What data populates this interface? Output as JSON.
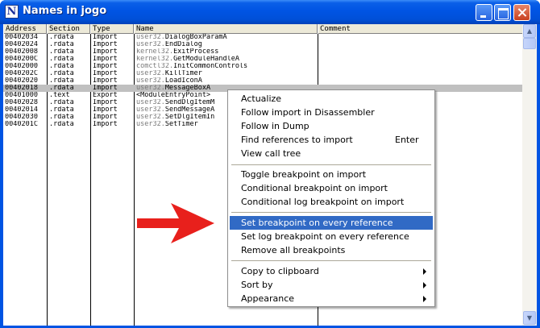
{
  "window": {
    "title": "Names in jogo",
    "icon_letter": "N"
  },
  "table": {
    "headers": [
      "Address",
      "Section",
      "Type",
      "Name",
      "Comment"
    ],
    "rows": [
      {
        "address": "00402034",
        "section": ".rdata",
        "type": "Import",
        "module": "user32.",
        "func": "DialogBoxParamA"
      },
      {
        "address": "00402024",
        "section": ".rdata",
        "type": "Import",
        "module": "user32.",
        "func": "EndDialog"
      },
      {
        "address": "00402008",
        "section": ".rdata",
        "type": "Import",
        "module": "kernel32.",
        "func": "ExitProcess"
      },
      {
        "address": "0040200C",
        "section": ".rdata",
        "type": "Import",
        "module": "kernel32.",
        "func": "GetModuleHandleA"
      },
      {
        "address": "00402000",
        "section": ".rdata",
        "type": "Import",
        "module": "comctl32.",
        "func": "InitCommonControls"
      },
      {
        "address": "0040202C",
        "section": ".rdata",
        "type": "Import",
        "module": "user32.",
        "func": "KillTimer"
      },
      {
        "address": "00402020",
        "section": ".rdata",
        "type": "Import",
        "module": "user32.",
        "func": "LoadIconA"
      },
      {
        "address": "00402018",
        "section": ".rdata",
        "type": "Import",
        "module": "user32.",
        "func": "MessageBoxA"
      },
      {
        "address": "00401000",
        "section": ".text",
        "type": "Export",
        "module": "",
        "func": "<ModuleEntryPoint>"
      },
      {
        "address": "00402028",
        "section": ".rdata",
        "type": "Import",
        "module": "user32.",
        "func": "SendDlgItemM"
      },
      {
        "address": "00402014",
        "section": ".rdata",
        "type": "Import",
        "module": "user32.",
        "func": "SendMessageA"
      },
      {
        "address": "00402030",
        "section": ".rdata",
        "type": "Import",
        "module": "user32.",
        "func": "SetDlgItemIn"
      },
      {
        "address": "0040201C",
        "section": ".rdata",
        "type": "Import",
        "module": "user32.",
        "func": "SetTimer"
      }
    ],
    "selected_row": 7
  },
  "context_menu": {
    "items": [
      {
        "label": "Actualize"
      },
      {
        "label": "Follow import in Disassembler"
      },
      {
        "label": "Follow in Dump"
      },
      {
        "label": "Find references to import",
        "shortcut": "Enter"
      },
      {
        "label": "View call tree"
      },
      {
        "label": "Toggle breakpoint on import"
      },
      {
        "label": "Conditional breakpoint on import"
      },
      {
        "label": "Conditional log breakpoint on import"
      },
      {
        "label": "Set breakpoint on every reference"
      },
      {
        "label": "Set log breakpoint on every reference"
      },
      {
        "label": "Remove all breakpoints"
      },
      {
        "label": "Copy to clipboard"
      },
      {
        "label": "Sort by"
      },
      {
        "label": "Appearance"
      }
    ],
    "highlighted_index": 8
  },
  "colors": {
    "titlebar": "#0054e3",
    "menu_highlight": "#316ac5",
    "arrow": "#e8201c",
    "selected_row": "#c0c0c0",
    "module_prefix": "#7a7a7a"
  },
  "icons": [
    "app-icon",
    "minimize-icon",
    "maximize-icon",
    "close-icon",
    "scroll-up-icon",
    "scroll-down-icon",
    "submenu-arrow-icon",
    "red-pointer-arrow"
  ]
}
